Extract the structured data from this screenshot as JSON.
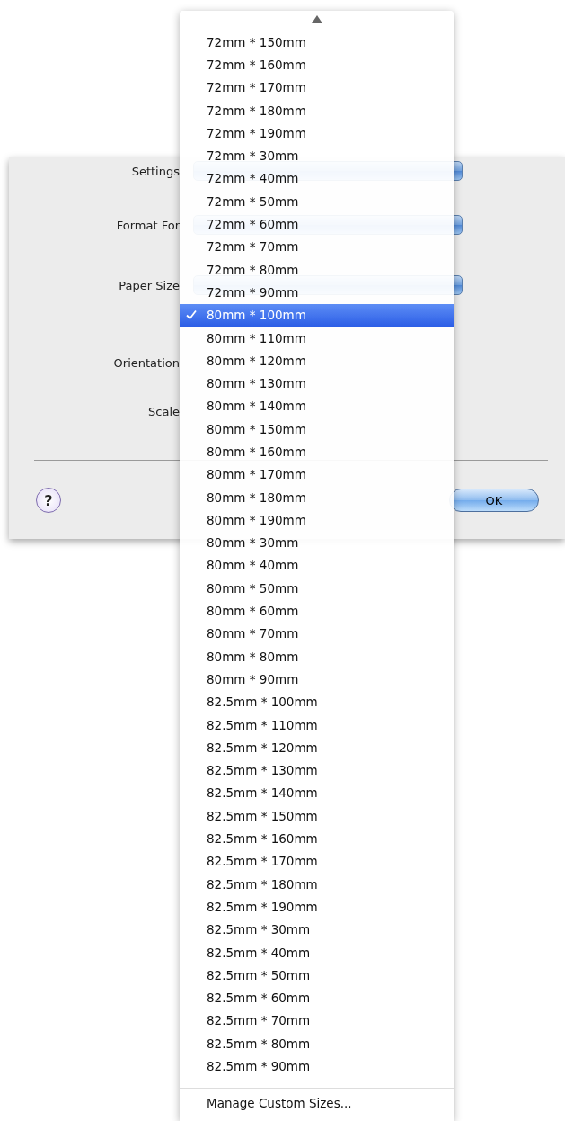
{
  "dialog": {
    "fields": [
      {
        "label": "Settings",
        "kind": "popup"
      },
      {
        "label": "Format For",
        "kind": "popup"
      },
      {
        "label": "Paper Size",
        "kind": "popup"
      },
      {
        "label": "Orientation",
        "kind": "plain"
      },
      {
        "label": "Scale",
        "kind": "plain"
      }
    ],
    "help_button": {
      "label": "?"
    },
    "buttons": [
      {
        "label": "OK",
        "default": true
      }
    ]
  },
  "menu": {
    "items": [
      {
        "label": "72mm * 150mm",
        "selected": false
      },
      {
        "label": "72mm * 160mm",
        "selected": false
      },
      {
        "label": "72mm * 170mm",
        "selected": false
      },
      {
        "label": "72mm * 180mm",
        "selected": false
      },
      {
        "label": "72mm * 190mm",
        "selected": false
      },
      {
        "label": "72mm * 30mm",
        "selected": false
      },
      {
        "label": "72mm * 40mm",
        "selected": false
      },
      {
        "label": "72mm * 50mm",
        "selected": false
      },
      {
        "label": "72mm * 60mm",
        "selected": false
      },
      {
        "label": "72mm * 70mm",
        "selected": false
      },
      {
        "label": "72mm * 80mm",
        "selected": false
      },
      {
        "label": "72mm * 90mm",
        "selected": false
      },
      {
        "label": "80mm * 100mm",
        "selected": true
      },
      {
        "label": "80mm * 110mm",
        "selected": false
      },
      {
        "label": "80mm * 120mm",
        "selected": false
      },
      {
        "label": "80mm * 130mm",
        "selected": false
      },
      {
        "label": "80mm * 140mm",
        "selected": false
      },
      {
        "label": "80mm * 150mm",
        "selected": false
      },
      {
        "label": "80mm * 160mm",
        "selected": false
      },
      {
        "label": "80mm * 170mm",
        "selected": false
      },
      {
        "label": "80mm * 180mm",
        "selected": false
      },
      {
        "label": "80mm * 190mm",
        "selected": false
      },
      {
        "label": "80mm * 30mm",
        "selected": false
      },
      {
        "label": "80mm * 40mm",
        "selected": false
      },
      {
        "label": "80mm * 50mm",
        "selected": false
      },
      {
        "label": "80mm * 60mm",
        "selected": false
      },
      {
        "label": "80mm * 70mm",
        "selected": false
      },
      {
        "label": "80mm * 80mm",
        "selected": false
      },
      {
        "label": "80mm * 90mm",
        "selected": false
      },
      {
        "label": "82.5mm * 100mm",
        "selected": false
      },
      {
        "label": "82.5mm * 110mm",
        "selected": false
      },
      {
        "label": "82.5mm * 120mm",
        "selected": false
      },
      {
        "label": "82.5mm * 130mm",
        "selected": false
      },
      {
        "label": "82.5mm * 140mm",
        "selected": false
      },
      {
        "label": "82.5mm * 150mm",
        "selected": false
      },
      {
        "label": "82.5mm * 160mm",
        "selected": false
      },
      {
        "label": "82.5mm * 170mm",
        "selected": false
      },
      {
        "label": "82.5mm * 180mm",
        "selected": false
      },
      {
        "label": "82.5mm * 190mm",
        "selected": false
      },
      {
        "label": "82.5mm * 30mm",
        "selected": false
      },
      {
        "label": "82.5mm * 40mm",
        "selected": false
      },
      {
        "label": "82.5mm * 50mm",
        "selected": false
      },
      {
        "label": "82.5mm * 60mm",
        "selected": false
      },
      {
        "label": "82.5mm * 70mm",
        "selected": false
      },
      {
        "label": "82.5mm * 80mm",
        "selected": false
      },
      {
        "label": "82.5mm * 90mm",
        "selected": false
      }
    ],
    "footer_items": [
      {
        "label": "Manage Custom Sizes..."
      }
    ]
  }
}
